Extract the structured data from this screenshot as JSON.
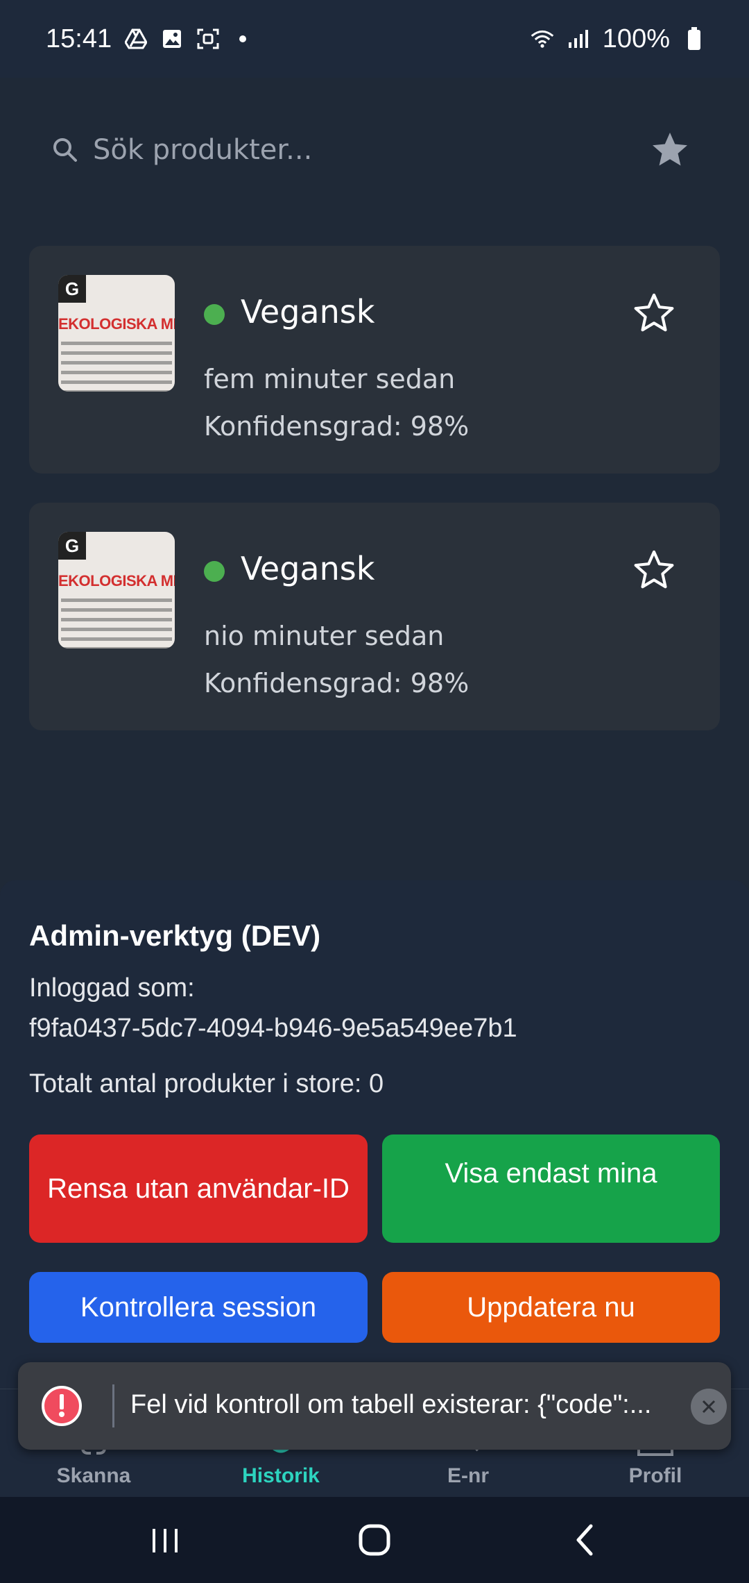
{
  "status_bar": {
    "time": "15:41",
    "battery": "100%",
    "icons": [
      "drive-icon",
      "image-icon",
      "screenshot-icon",
      "wifi-icon",
      "signal-icon",
      "battery-icon"
    ]
  },
  "search": {
    "placeholder": "Sök produkter..."
  },
  "history": [
    {
      "verdict": "Vegansk",
      "status_color": "#4caf50",
      "time": "fem minuter sedan",
      "confidence": "Konfidensgrad: 98%",
      "thumb_heading": "EKOLOGISKA MIKROP"
    },
    {
      "verdict": "Vegansk",
      "status_color": "#4caf50",
      "time": "nio minuter sedan",
      "confidence": "Konfidensgrad: 98%",
      "thumb_heading": "EKOLOGISKA MIKROP"
    }
  ],
  "admin": {
    "title": "Admin-verktyg (DEV)",
    "logged_in_label": "Inloggad som:",
    "user_id": "f9fa0437-5dc7-4094-b946-9e5a549ee7b1",
    "total_products": "Totalt antal produkter i store: 0",
    "buttons": {
      "clear": "Rensa utan användar-ID",
      "show_mine": "Visa endast mina",
      "check_session": "Kontrollera session",
      "refresh": "Uppdatera nu"
    },
    "colors": {
      "clear": "#dc2626",
      "show_mine": "#16a34a",
      "check_session": "#2563eb",
      "refresh": "#ea580c"
    }
  },
  "tabs": [
    {
      "label": "Skanna",
      "icon": "scan-icon",
      "active": false
    },
    {
      "label": "Historik",
      "icon": "history-icon",
      "active": true
    },
    {
      "label": "E-nr",
      "icon": "search-icon",
      "active": false
    },
    {
      "label": "Profil",
      "icon": "profile-icon",
      "active": false
    }
  ],
  "toast": {
    "message": "Fel vid kontroll om tabell existerar: {\"code\":..."
  },
  "accent_color": "#2dd4bf"
}
